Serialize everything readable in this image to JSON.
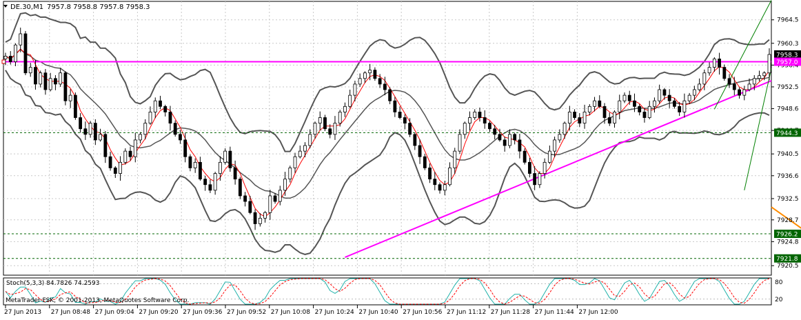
{
  "chart_data": {
    "type": "candlestick",
    "title": "DE.30,M1",
    "ohlc_readout": "7957.8 7958.8 7957.8 7958.3",
    "price_axis": {
      "range": [
        7918.8,
        7967.8
      ],
      "ticks": [
        7964.5,
        7960.3,
        7956.4,
        7952.5,
        7948.6,
        7944.7,
        7940.5,
        7936.6,
        7932.5,
        7928.7,
        7924.8,
        7920.5
      ]
    },
    "time_axis": {
      "labels": [
        "27 Jun 2013",
        "27 Jun 08:48",
        "27 Jun 09:04",
        "27 Jun 09:20",
        "27 Jun 09:36",
        "27 Jun 09:52",
        "27 Jun 10:08",
        "27 Jun 10:24",
        "27 Jun 10:40",
        "27 Jun 10:56",
        "27 Jun 11:12",
        "27 Jun 11:28",
        "27 Jun 11:44",
        "27 Jun 12:00"
      ]
    },
    "price_labels": {
      "last_price": {
        "value": "7958.3",
        "color": "#000000"
      },
      "resistance": {
        "value": "7957.0",
        "color": "#ff00ff"
      },
      "levels": [
        {
          "value": "7944.3",
          "color": "#006400"
        },
        {
          "value": "7926.2",
          "color": "#006400"
        },
        {
          "value": "7921.8",
          "color": "#006400"
        }
      ]
    },
    "close_series": [
      7958,
      7957,
      7960,
      7962,
      7955,
      7956,
      7953,
      7955,
      7952,
      7954,
      7953,
      7955,
      7950,
      7951,
      7947,
      7945,
      7944,
      7946,
      7943,
      7944,
      7940,
      7938,
      7937,
      7939,
      7941,
      7940,
      7943,
      7944,
      7946,
      7948,
      7950,
      7949,
      7948,
      7946,
      7944,
      7943,
      7940,
      7938,
      7939,
      7936,
      7935,
      7934,
      7937,
      7939,
      7941,
      7938,
      7936,
      7933,
      7932,
      7930,
      7928,
      7929,
      7930,
      7933,
      7932,
      7934,
      7936,
      7938,
      7940,
      7941,
      7942,
      7944,
      7946,
      7947,
      7945,
      7944,
      7946,
      7948,
      7949,
      7951,
      7953,
      7954,
      7955,
      7955.5,
      7954,
      7953,
      7952,
      7950,
      7948,
      7947,
      7946,
      7944,
      7942,
      7940,
      7938,
      7936,
      7935,
      7934,
      7935,
      7938,
      7941,
      7944,
      7946,
      7947,
      7948,
      7947,
      7946,
      7945,
      7944,
      7943,
      7942,
      7944,
      7943,
      7941,
      7939,
      7937,
      7935,
      7937,
      7939,
      7941,
      7943,
      7944,
      7946,
      7948,
      7947,
      7946,
      7948,
      7949,
      7950,
      7949,
      7947,
      7946,
      7948,
      7950,
      7951,
      7950,
      7949,
      7948,
      7947,
      7949,
      7950,
      7952,
      7951,
      7950,
      7949,
      7948,
      7950,
      7951,
      7952,
      7953,
      7955,
      7956,
      7957.5,
      7956,
      7954,
      7953,
      7952,
      7951,
      7952,
      7953,
      7954,
      7954.5,
      7955,
      7958.3
    ],
    "indicators": {
      "bollinger": {
        "color": "#555555"
      },
      "moving_average": {
        "color": "#ff0000"
      }
    },
    "trendlines": [
      {
        "name": "support",
        "color": "#ff00ff",
        "from": {
          "bar": 68,
          "price": 7922.0
        },
        "to_right_edge_price": 7953.6
      },
      {
        "name": "channel-upper",
        "color": "#008000",
        "from": {
          "bar": 142,
          "price": 7948.5
        },
        "to_right_edge_price": 7968.0
      },
      {
        "name": "channel-lower",
        "color": "#008000",
        "from": {
          "bar": 148,
          "price": 7934.0
        },
        "to_right_edge_price": 7955.8
      },
      {
        "name": "lower-orange",
        "color": "#ff8c00",
        "from": {
          "bar": 170,
          "price": 7920.5
        },
        "to_right_edge_price": 7931.0
      }
    ],
    "stochastic": {
      "label": "Stoch(5,3,3) 84.7826 74.2593",
      "axis_labels": [
        "80",
        "20"
      ],
      "main_color": "#20b2aa",
      "signal_color": "#ff0000"
    },
    "copyright": "MetaTrader FSK, © 2001-2013, MetaQuotes Software Corp."
  }
}
